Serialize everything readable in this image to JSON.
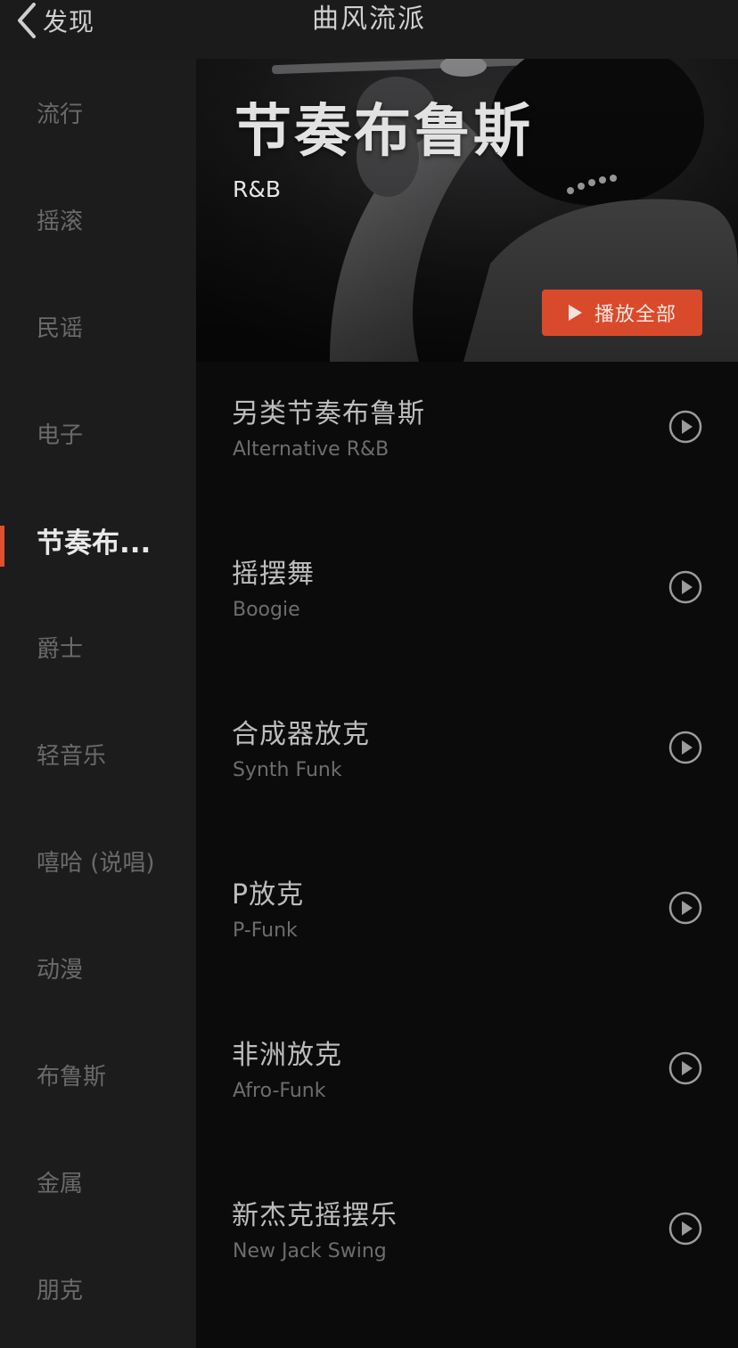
{
  "header": {
    "back_label": "发现",
    "title": "曲风流派"
  },
  "sidebar": {
    "items": [
      {
        "label": "流行"
      },
      {
        "label": "摇滚"
      },
      {
        "label": "民谣"
      },
      {
        "label": "电子"
      },
      {
        "label": "节奏布..."
      },
      {
        "label": "爵士"
      },
      {
        "label": "轻音乐"
      },
      {
        "label": "嘻哈 (说唱)"
      },
      {
        "label": "动漫"
      },
      {
        "label": "布鲁斯"
      },
      {
        "label": "金属"
      },
      {
        "label": "朋克"
      }
    ],
    "active_index": 4
  },
  "banner": {
    "title": "节奏布鲁斯",
    "subtitle": "R&B",
    "play_all_label": "播放全部"
  },
  "genres": [
    {
      "zh": "另类节奏布鲁斯",
      "en": "Alternative R&B"
    },
    {
      "zh": "摇摆舞",
      "en": "Boogie"
    },
    {
      "zh": "合成器放克",
      "en": "Synth Funk"
    },
    {
      "zh": "P放克",
      "en": "P-Funk"
    },
    {
      "zh": "非洲放克",
      "en": "Afro-Funk"
    },
    {
      "zh": "新杰克摇摆乐",
      "en": "New Jack Swing"
    }
  ],
  "colors": {
    "accent": "#d94a2b",
    "active_indicator": "#e0502f",
    "background": "#0b0b0c",
    "sidebar_background": "#1c1c1d"
  },
  "icons": {
    "back": "chevron-left-icon",
    "play_all": "play-triangle-icon",
    "row_play": "play-circle-icon"
  }
}
